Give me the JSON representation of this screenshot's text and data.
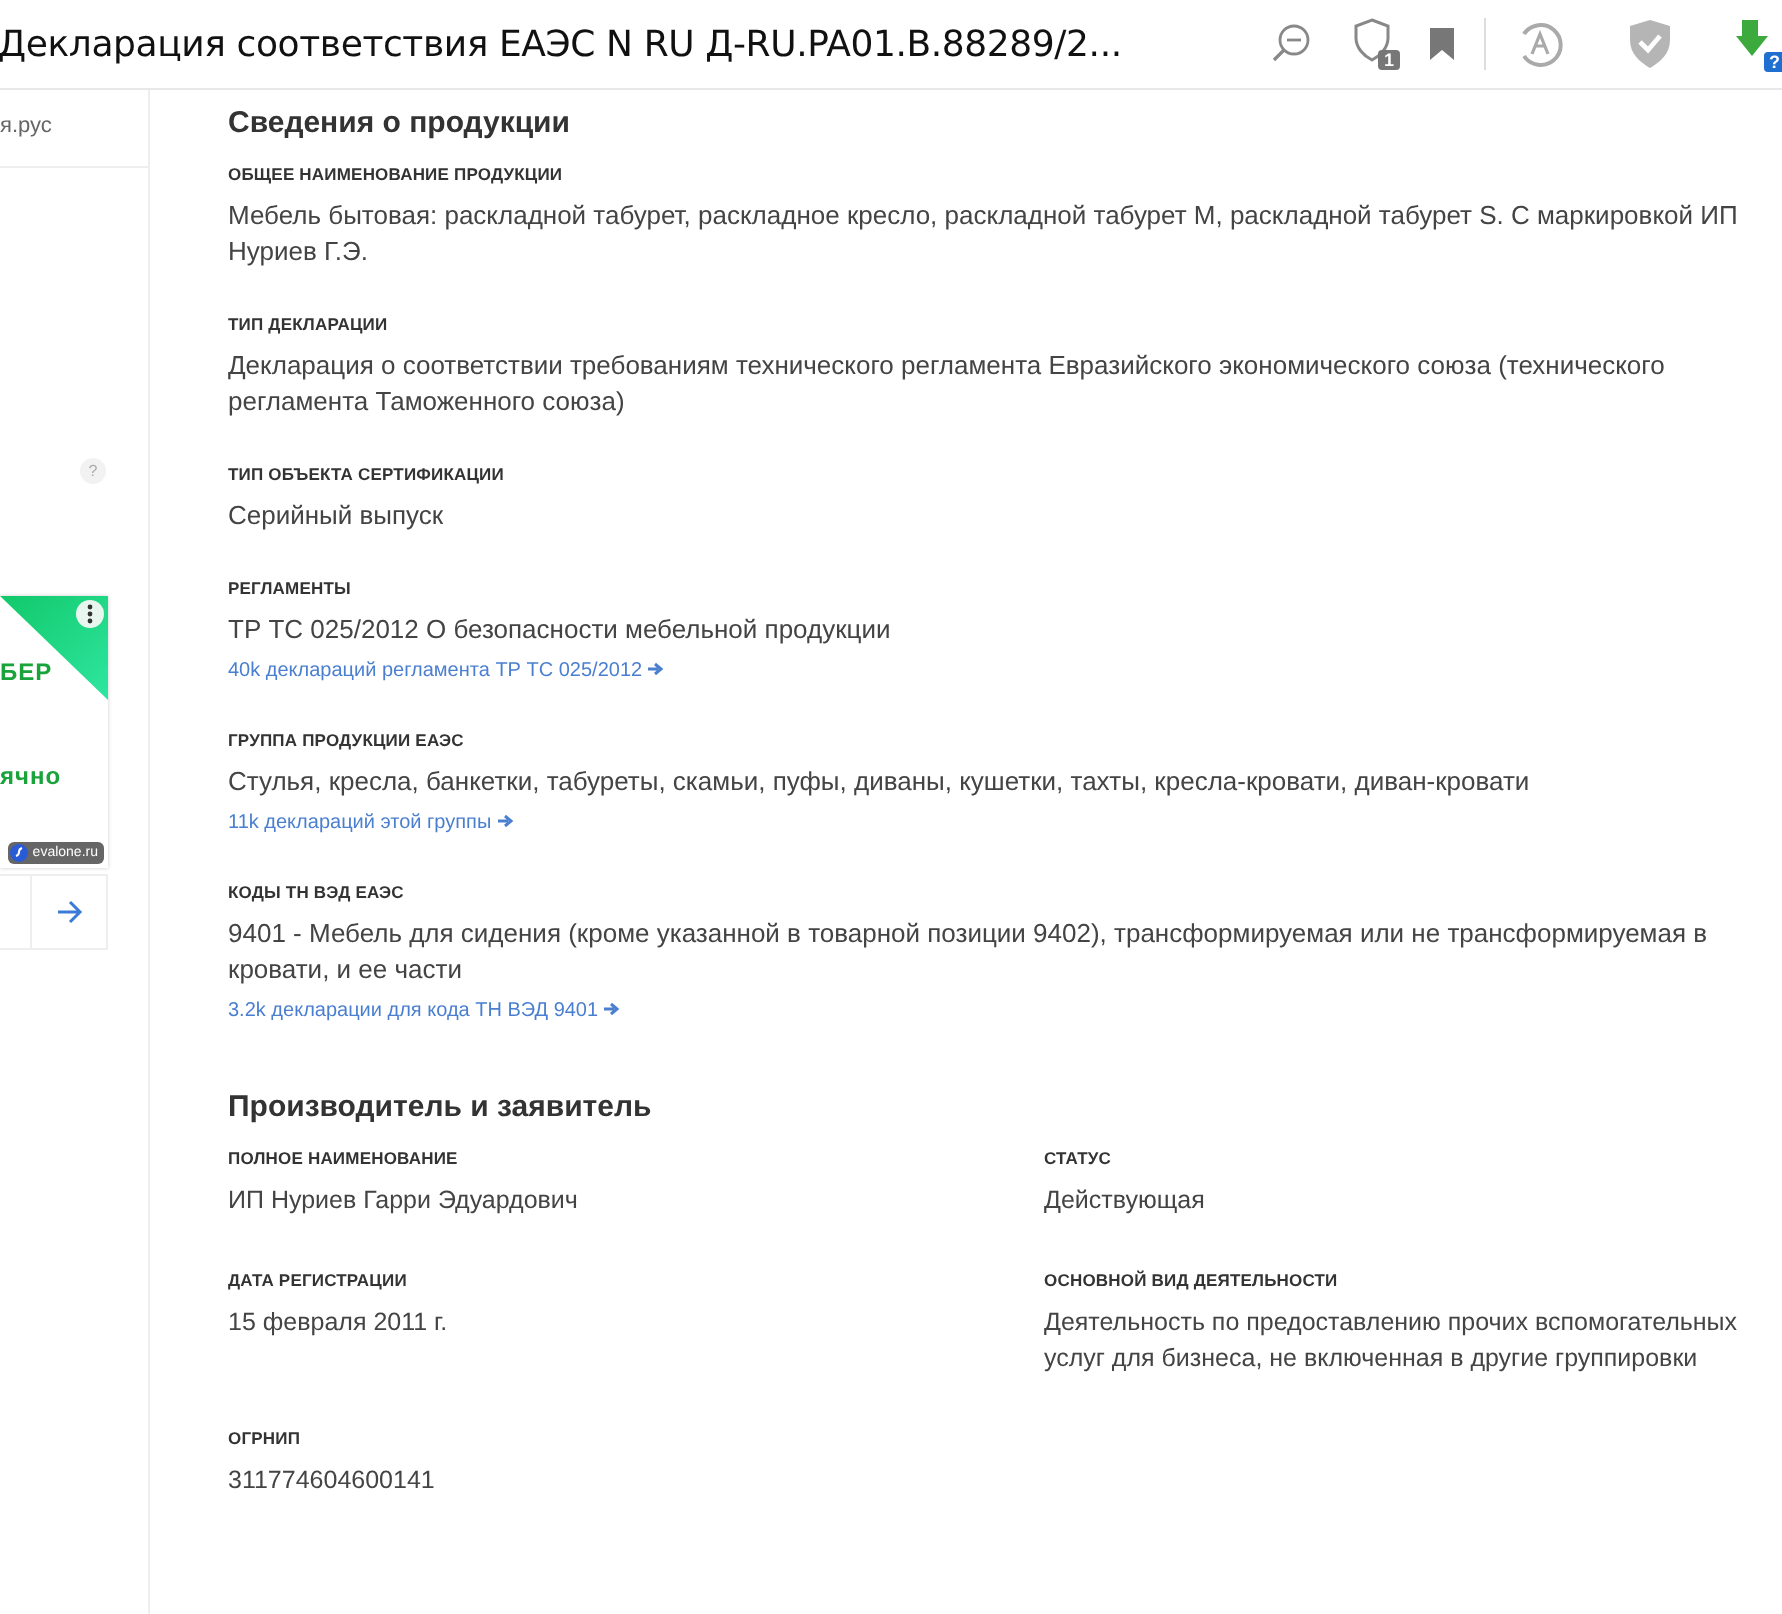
{
  "header": {
    "title": "Декларация соответствия ЕАЭС N RU Д-RU.PA01.B.88289/2...",
    "badge_count": "1",
    "help_mark": "?"
  },
  "sidebar": {
    "site": "я.рус",
    "help": "?",
    "ad": {
      "line_1": "БЕР",
      "line_2": "ячно",
      "source": "evalone.ru"
    }
  },
  "product": {
    "title": "Сведения о продукции",
    "fields": [
      {
        "label": "ОБЩЕЕ НАИМЕНОВАНИЕ ПРОДУКЦИИ",
        "value": "Мебель бытовая: раскладной табурет, раскладное кресло, раскладной табурет M, раскладной табурет S. С маркировкой ИП Нуриев Г.Э."
      },
      {
        "label": "ТИП ДЕКЛАРАЦИИ",
        "value": "Декларация о соответствии требованиям технического регламента Евразийского экономического союза (технического регламента Таможенного союза)"
      },
      {
        "label": "ТИП ОБЪЕКТА СЕРТИФИКАЦИИ",
        "value": "Серийный выпуск"
      },
      {
        "label": "РЕГЛАМЕНТЫ",
        "value": "ТР ТС 025/2012 О безопасности мебельной продукции",
        "link": "40k деклараций регламента ТР ТС 025/2012"
      },
      {
        "label": "ГРУППА ПРОДУКЦИИ ЕАЭС",
        "value": "Стулья, кресла, банкетки, табуреты, скамьи, пуфы, диваны, кушетки, тахты, кресла-кровати, диван-кровати",
        "link": "11k деклараций этой группы"
      },
      {
        "label": "КОДЫ ТН ВЭД ЕАЭС",
        "value": "9401 - Мебель для сидения (кроме указанной в товарной позиции 9402), трансформируемая или не трансформируемая в кровати, и ее части",
        "link": "3.2k декларации для кода ТН ВЭД 9401"
      }
    ]
  },
  "manufacturer": {
    "title": "Производитель и заявитель",
    "fields": [
      {
        "label": "ПОЛНОЕ НАИМЕНОВАНИЕ",
        "value": "ИП Нуриев Гарри Эдуардович"
      },
      {
        "label": "СТАТУС",
        "value": "Действующая"
      },
      {
        "label": "ДАТА РЕГИСТРАЦИИ",
        "value": "15 февраля 2011 г."
      },
      {
        "label": "ОСНОВНОЙ ВИД ДЕЯТЕЛЬНОСТИ",
        "value": "Деятельность по предоставлению прочих вспомогательных услуг для бизнеса, не включенная в другие группировки"
      },
      {
        "label": "ОГРНИП",
        "value": "311774604600141"
      }
    ]
  }
}
